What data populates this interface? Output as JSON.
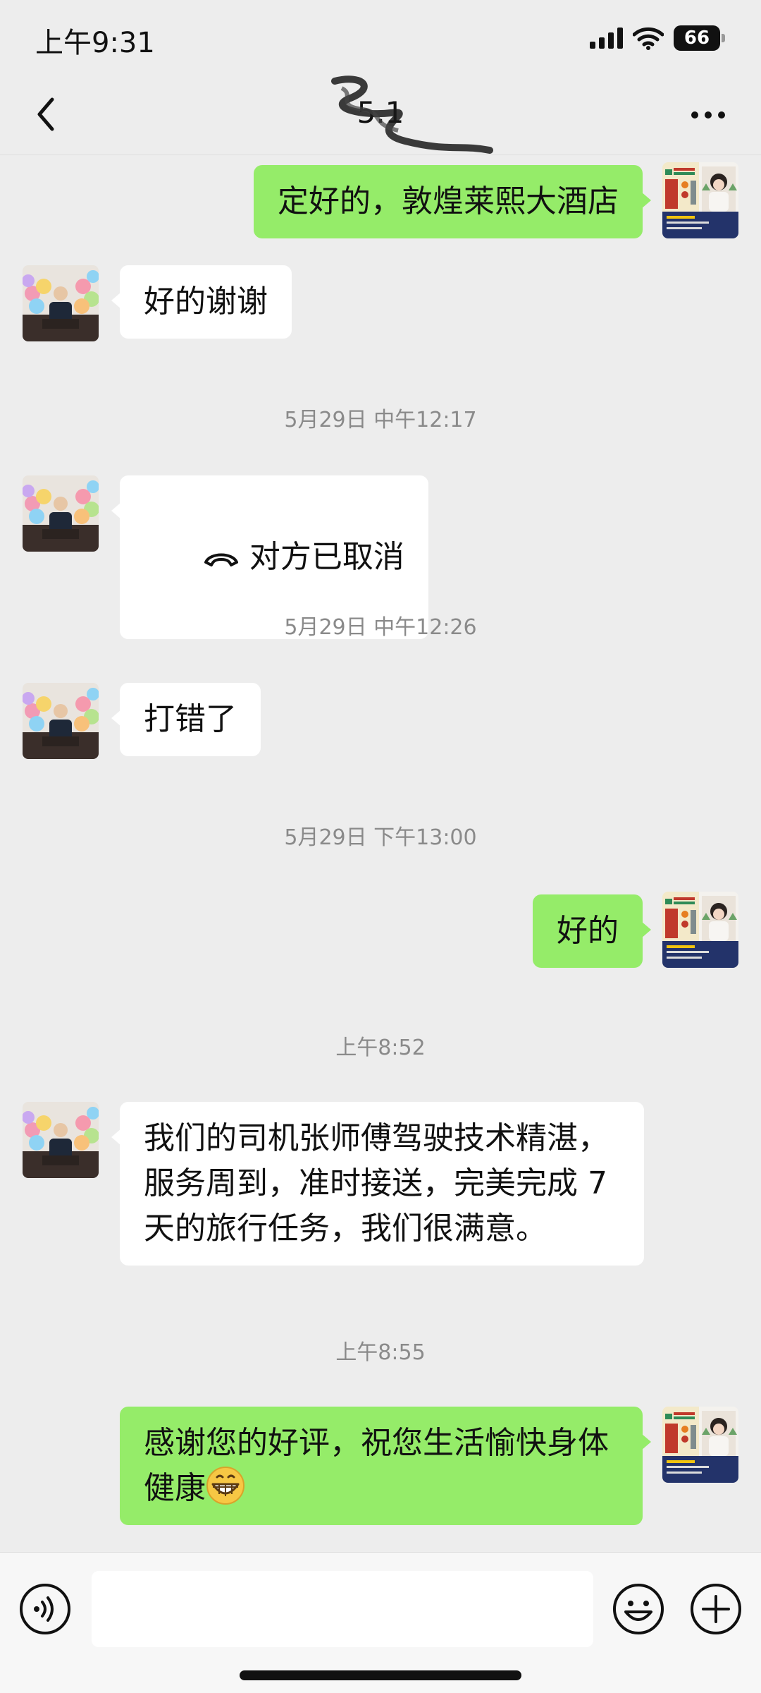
{
  "status_bar": {
    "time": "上午9:31",
    "battery": "66",
    "icons": [
      "signal-icon",
      "wifi-icon",
      "battery-icon"
    ]
  },
  "nav": {
    "title": "5.1",
    "back_icon": "chevron-left-icon",
    "more_icon": "more-dots-icon"
  },
  "messages": [
    {
      "side": "out",
      "text": "定好的，敦煌莱熙大酒店"
    },
    {
      "side": "in",
      "text": "好的谢谢"
    },
    {
      "timestamp": "5月29日 中午12:17"
    },
    {
      "side": "in",
      "text": "对方已取消",
      "icon": "call-cancelled-icon"
    },
    {
      "timestamp": "5月29日 中午12:26"
    },
    {
      "side": "in",
      "text": "打错了"
    },
    {
      "timestamp": "5月29日 下午13:00"
    },
    {
      "side": "out",
      "text": "好的"
    },
    {
      "timestamp": "上午8:52"
    },
    {
      "side": "in",
      "text": "我们的司机张师傅驾驶技术精湛，\n服务周到，准时接送，完美完成 7\n天的旅行任务，我们很满意。"
    },
    {
      "timestamp": "上午8:55"
    },
    {
      "side": "out",
      "text": "感谢您的好评，祝您生活愉快身体\n健康",
      "emoji": "grinning-face-emoji"
    }
  ],
  "input_bar": {
    "voice_icon": "voice-icon",
    "emoji_icon": "emoji-icon",
    "plus_icon": "plus-icon",
    "placeholder": ""
  },
  "colors": {
    "background": "#EDEDED",
    "outgoing_bubble": "#95EC69",
    "incoming_bubble": "#FFFFFF",
    "timestamp": "#8A8A8A"
  }
}
